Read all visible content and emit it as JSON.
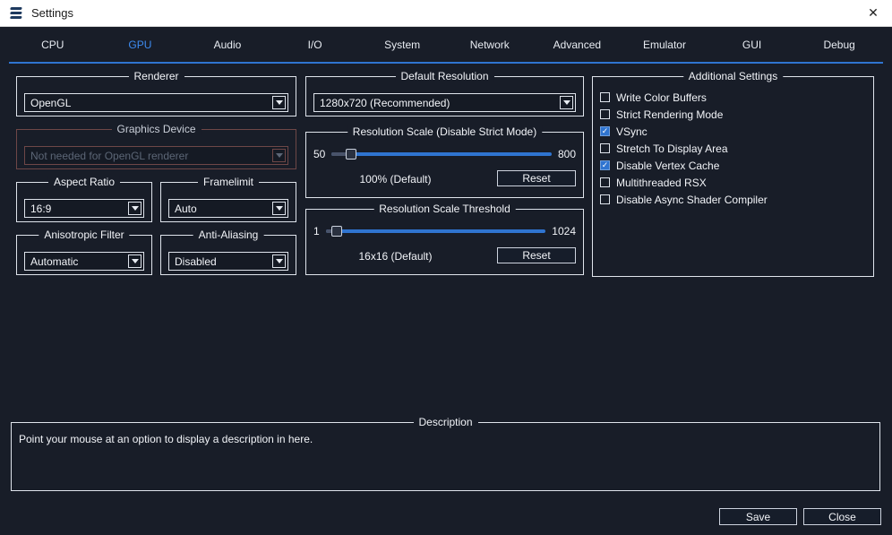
{
  "colors": {
    "accent": "#2f74d0",
    "tab_active": "#3d8bf0",
    "window_bg": "#181d28",
    "titlebar_bg": "#ffffff"
  },
  "window": {
    "title": "Settings",
    "close_glyph": "✕"
  },
  "active_tab": "GPU",
  "tabs": [
    "CPU",
    "GPU",
    "Audio",
    "I/O",
    "System",
    "Network",
    "Advanced",
    "Emulator",
    "GUI",
    "Debug"
  ],
  "gpu": {
    "renderer": {
      "label": "Renderer",
      "value": "OpenGL"
    },
    "graphics_device": {
      "label": "Graphics Device",
      "value": "Not needed for OpenGL renderer",
      "disabled": true
    },
    "aspect_ratio": {
      "label": "Aspect Ratio",
      "value": "16:9"
    },
    "framelimit": {
      "label": "Framelimit",
      "value": "Auto"
    },
    "anisotropic_filter": {
      "label": "Anisotropic Filter",
      "value": "Automatic"
    },
    "anti_aliasing": {
      "label": "Anti-Aliasing",
      "value": "Disabled"
    },
    "default_resolution": {
      "label": "Default Resolution",
      "value": "1280x720 (Recommended)"
    },
    "resolution_scale": {
      "label": "Resolution Scale (Disable Strict Mode)",
      "min": "50",
      "max": "800",
      "value_label": "100% (Default)",
      "reset_label": "Reset",
      "handle_percent": 9
    },
    "resolution_scale_threshold": {
      "label": "Resolution Scale Threshold",
      "min": "1",
      "max": "1024",
      "value_label": "16x16 (Default)",
      "reset_label": "Reset",
      "handle_percent": 5
    },
    "additional_settings": {
      "label": "Additional Settings",
      "items": [
        {
          "label": "Write Color Buffers",
          "checked": false
        },
        {
          "label": "Strict Rendering Mode",
          "checked": false
        },
        {
          "label": "VSync",
          "checked": true
        },
        {
          "label": "Stretch To Display Area",
          "checked": false
        },
        {
          "label": "Disable Vertex Cache",
          "checked": true
        },
        {
          "label": "Multithreaded RSX",
          "checked": false
        },
        {
          "label": "Disable Async Shader Compiler",
          "checked": false
        }
      ]
    }
  },
  "description": {
    "label": "Description",
    "text": "Point your mouse at an option to display a description in here."
  },
  "footer": {
    "save_label": "Save",
    "close_label": "Close"
  }
}
